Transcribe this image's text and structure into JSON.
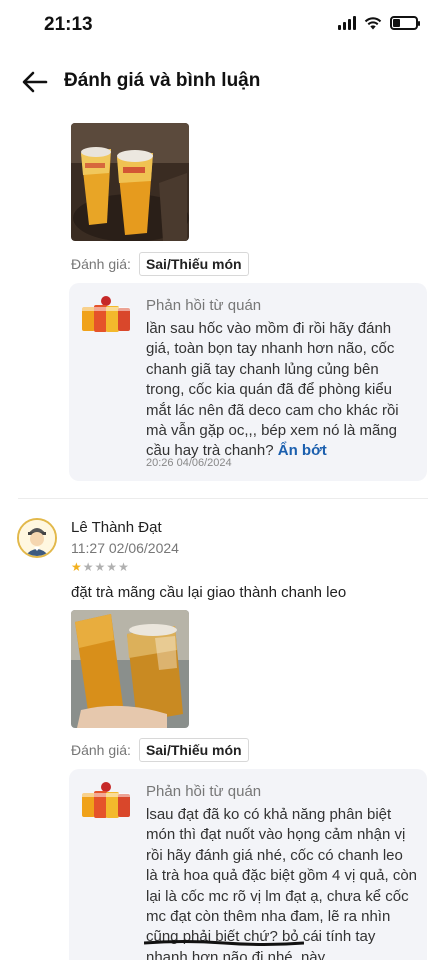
{
  "status_bar": {
    "time": "21:13",
    "battery_level": 0.3
  },
  "header": {
    "title": "Đánh giá và bình luận"
  },
  "reviews": [
    {
      "rating_label": "Đánh giá:",
      "tag": "Sai/Thiếu món",
      "reply": {
        "title": "Phản hồi từ quán",
        "text": "lần sau hốc vào mồm đi rồi hãy đánh giá, toàn bọn tay nhanh hơn não, cốc chanh giã tay chanh lủng củng bên trong, cốc kia quán đã để phòng kiểu mắt lác nên đã deco cam cho khác rồi mà vẫn gặp oc,,, bép xem nó là mãng cầu hay trà chanh?",
        "collapse_label": "Ẩn bớt",
        "date": "20:26 04/06/2024"
      }
    },
    {
      "name": "Lê Thành Đạt",
      "time": "11:27 02/06/2024",
      "stars": 1,
      "max_stars": 5,
      "text": "đặt trà mãng cầu lại giao thành chanh leo",
      "rating_label": "Đánh giá:",
      "tag": "Sai/Thiếu món",
      "reply": {
        "title": "Phản hồi từ quán",
        "text": "lsau đạt đã ko có khả năng phân biệt món thì đạt nuốt vào họng cảm nhận vị rồi hãy đánh giá nhé, cốc có chanh leo là trà hoa quả đặc biệt gồm 4 vị quả, còn lại là cốc mc rõ vị lm đạt ạ, chưa kể cốc mc đạt còn thêm nha đam, lẽ ra nhìn cũng phải biết chứ? bỏ cái tính tay nhanh hơn não đi nhé ,này"
      }
    }
  ],
  "colors": {
    "link": "#1b5fae",
    "star": "#f2b01e",
    "reply_bg": "#f3f4f8"
  }
}
